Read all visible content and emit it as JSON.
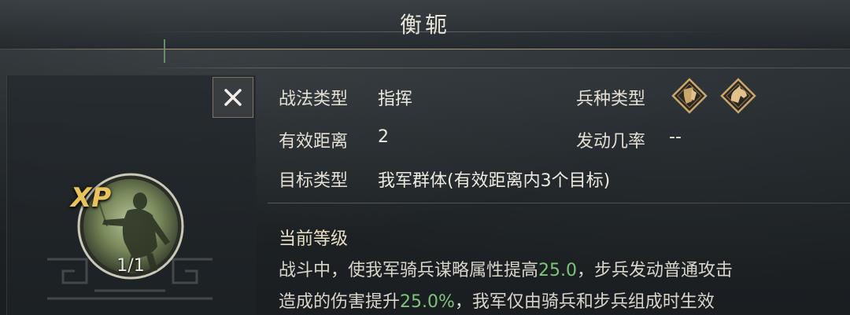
{
  "title": "衡轭",
  "close_icon": "close-icon",
  "badge": {
    "label": "XP",
    "count": "1/1"
  },
  "info": {
    "tactic_type_label": "战法类型",
    "tactic_type_value": "指挥",
    "troop_type_label": "兵种类型",
    "troop_icons": [
      "cavalry-shield-icon",
      "horse-head-icon"
    ],
    "range_label": "有效距离",
    "range_value": "2",
    "trigger_rate_label": "发动几率",
    "trigger_rate_value": "--",
    "target_label": "目标类型",
    "target_value": "我军群体(有效距离内3个目标)"
  },
  "level_section": {
    "title": "当前等级",
    "line1_a": "战斗中，使我军骑兵谋略属性提高",
    "line1_num": "25.0",
    "line1_b": "，步兵发动普通攻击",
    "line2_a": "造成的伤害提升",
    "line2_num": "25.0%",
    "line2_b": "，我军仅由骑兵和步兵组成时生效"
  },
  "colors": {
    "highlight": "#7dc47a",
    "gold": "#e8c35a",
    "icon_gold": "#c9a76a"
  }
}
